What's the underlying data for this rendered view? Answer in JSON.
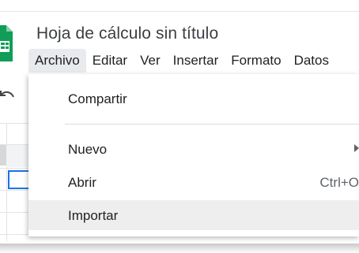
{
  "document": {
    "title": "Hoja de cálculo sin título"
  },
  "menubar": {
    "items": [
      {
        "label": "Archivo",
        "active": true
      },
      {
        "label": "Editar"
      },
      {
        "label": "Ver"
      },
      {
        "label": "Insertar"
      },
      {
        "label": "Formato"
      },
      {
        "label": "Datos"
      }
    ]
  },
  "file_menu": {
    "items": [
      {
        "label": "Compartir"
      },
      {
        "label": "Nuevo",
        "submenu": true
      },
      {
        "label": "Abrir",
        "shortcut": "Ctrl+O"
      },
      {
        "label": "Importar",
        "hovered": true
      }
    ]
  },
  "colors": {
    "logo_green": "#0f9d58",
    "selection_blue": "#1a73e8",
    "hover_gray": "#eeeeee"
  },
  "icons": [
    "sheets-logo-icon",
    "undo-icon",
    "submenu-arrow-icon"
  ]
}
